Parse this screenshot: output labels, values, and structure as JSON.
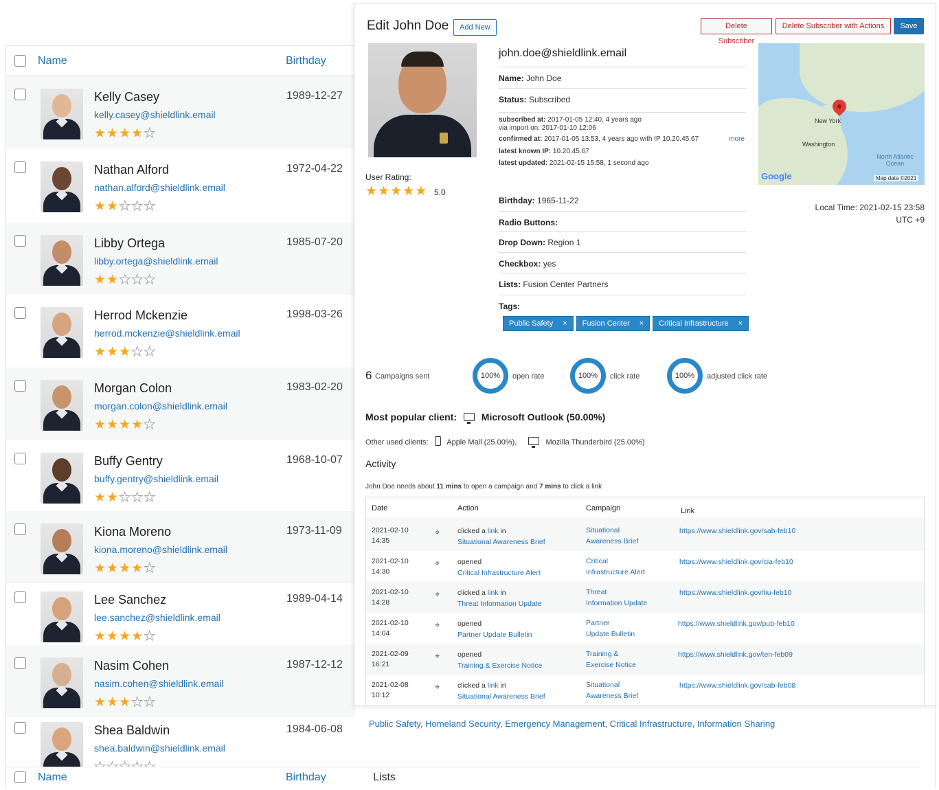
{
  "list": {
    "header": {
      "name": "Name",
      "birthday": "Birthday"
    },
    "footer": {
      "name": "Name",
      "birthday": "Birthday",
      "lists": "Lists"
    },
    "rows": [
      {
        "name": "Kelly Casey",
        "email": "kelly.casey@shieldlink.email",
        "birthday": "1989-12-27",
        "stars": 4
      },
      {
        "name": "Nathan Alford",
        "email": "nathan.alford@shieldlink.email",
        "birthday": "1972-04-22",
        "stars": 2
      },
      {
        "name": "Libby Ortega",
        "email": "libby.ortega@shieldlink.email",
        "birthday": "1985-07-20",
        "stars": 2
      },
      {
        "name": "Herrod Mckenzie",
        "email": "herrod.mckenzie@shieldlink.email",
        "birthday": "1998-03-26",
        "stars": 3
      },
      {
        "name": "Morgan Colon",
        "email": "morgan.colon@shieldlink.email",
        "birthday": "1983-02-20",
        "stars": 4
      },
      {
        "name": "Buffy Gentry",
        "email": "buffy.gentry@shieldlink.email",
        "birthday": "1968-10-07",
        "stars": 2
      },
      {
        "name": "Kiona Moreno",
        "email": "kiona.moreno@shieldlink.email",
        "birthday": "1973-11-09",
        "stars": 4
      },
      {
        "name": "Lee Sanchez",
        "email": "lee.sanchez@shieldlink.email",
        "birthday": "1989-04-14",
        "stars": 4
      },
      {
        "name": "Nasim Cohen",
        "email": "nasim.cohen@shieldlink.email",
        "birthday": "1987-12-12",
        "stars": 3
      },
      {
        "name": "Shea Baldwin",
        "email": "shea.baldwin@shieldlink.email",
        "birthday": "1984-06-08",
        "stars": 0
      }
    ],
    "lists_links": "Public Safety, Homeland Security, Emergency Management, Critical Infrastructure, Information Sharing"
  },
  "panel": {
    "title": "Edit John Doe",
    "add_new": "Add New",
    "delete_subscriber": "Delete Subscriber",
    "delete_with_actions": "Delete Subscriber with Actions",
    "save": "Save",
    "email": "john.doe@shieldlink.email",
    "user_rating_label": "User Rating:",
    "user_rating_value": "5.0",
    "user_rating_stars": 5,
    "name_label": "Name:",
    "name_value": "John Doe",
    "status_label": "Status:",
    "status_value": "Subscribed",
    "meta": {
      "subscribed_label": "subscribed at:",
      "subscribed_value": "2017-01-05 12:40, 4 years ago",
      "import_line": "via import on: 2017-01-10 12:06",
      "confirmed_label": "confirmed at:",
      "confirmed_value": "2017-01-05 13:53, 4 years ago with IP 10.20.45.67",
      "more": "more",
      "known_ip_label": "latest known IP:",
      "known_ip_value": "10.20.45.67",
      "updated_label": "latest updated:",
      "updated_value": "2021-02-15 15:58, 1 second ago"
    },
    "birthday_label": "Birthday:",
    "birthday_value": "1965-11-22",
    "radio_label": "Radio Buttons:",
    "dropdown_label": "Drop Down:",
    "dropdown_value": "Region 1",
    "checkbox_label": "Checkbox:",
    "checkbox_value": "yes",
    "lists_label": "Lists:",
    "lists_value": "Fusion Center Partners",
    "tags_label": "Tags:",
    "tags": [
      "Public Safety",
      "Fusion Center",
      "Critical Infrastructure"
    ],
    "tag_remove": "×",
    "map": {
      "new_york": "New York",
      "washington": "Washington",
      "ocean": "North Atlantic Ocean",
      "google": "Google",
      "map_data": "Map data ©2021"
    },
    "local_time": "Local Time: 2021-02-15 23:58",
    "utc": "UTC +9",
    "stats": {
      "campaigns_count": "6",
      "campaigns_label": "Campaigns sent",
      "open_rate": "100%",
      "open_label": "open rate",
      "click_rate": "100%",
      "click_label": "click rate",
      "adjusted_rate": "100%",
      "adjusted_label": "adjusted click rate"
    },
    "popular_label": "Most popular client:",
    "popular_value": "Microsoft Outlook (50.00%)",
    "other_label": "Other used clients:",
    "other_1": "Apple Mail (25.00%),",
    "other_2": "Mozilla Thunderbird (25.00%)",
    "activity_title": "Activity",
    "activity_sub": {
      "pre": "John Doe needs about ",
      "open_mins": "11 mins",
      "mid": " to open a campaign and ",
      "click_mins": "7 mins",
      "post": " to click a link"
    },
    "activity_headers": {
      "date": "Date",
      "action": "Action",
      "campaign": "Campaign",
      "link": "Link"
    },
    "activity": [
      {
        "date": "2021-02-10",
        "time": "14:35",
        "verb": "clicked a",
        "link_word": "link",
        "in": " in",
        "target": "Situational Awareness Brief",
        "campaign_1": "Situational",
        "campaign_2": "Awareness Brief",
        "url": "https://www.shieldlink.gov/sab-feb10"
      },
      {
        "date": "2021-02-10",
        "time": "14:30",
        "verb": "opened",
        "link_word": "",
        "in": "",
        "target": "Critical Infrastructure Alert",
        "campaign_1": "Critical",
        "campaign_2": "Infrastructure Alert",
        "url": "https://www.shieldlink.gov/cia-feb10"
      },
      {
        "date": "2021-02-10",
        "time": "14:28",
        "verb": "clicked a",
        "link_word": "link",
        "in": " in",
        "target": "Threat Information Update",
        "campaign_1": "Threat",
        "campaign_2": "Information Update",
        "url": "https://www.shieldlink.gov/tiu-feb10"
      },
      {
        "date": "2021-02-10",
        "time": "14:04",
        "verb": "opened",
        "link_word": "",
        "in": "",
        "target": "Partner Update Bulletin",
        "campaign_1": "Partner",
        "campaign_2": "Update Bulletin",
        "url": "https://www.shieldlink.gov/pub-feb10"
      },
      {
        "date": "2021-02-09",
        "time": "16:21",
        "verb": "opened",
        "link_word": "",
        "in": "",
        "target": "Training & Exercise Notice",
        "campaign_1": "Training &",
        "campaign_2": "Exercise Notice",
        "url": "https://www.shieldlink.gov/ten-feb09"
      },
      {
        "date": "2021-02-08",
        "time": "10:12",
        "verb": "clicked a",
        "link_word": "link",
        "in": " in",
        "target": "Situational Awareness Brief",
        "campaign_1": "Situational",
        "campaign_2": "Awareness Brief",
        "url": "https://www.shieldlink.gov/sab-feb08"
      }
    ]
  },
  "colors": {
    "accent": "#2271b1",
    "danger": "#b32d2e",
    "star": "#f5a623",
    "tag": "#2b88c8"
  }
}
